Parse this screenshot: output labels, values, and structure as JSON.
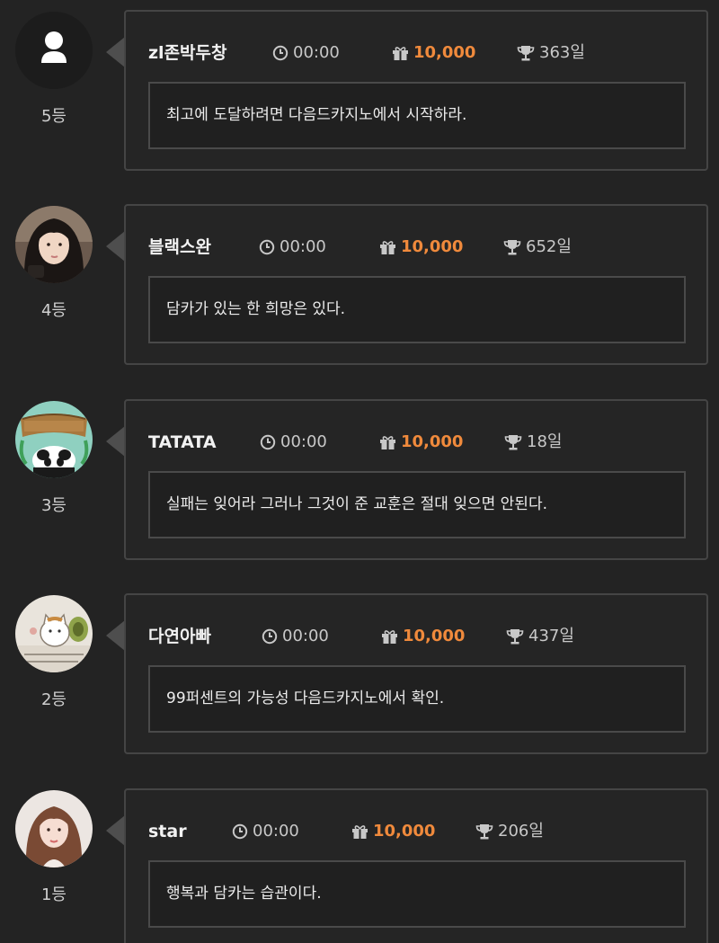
{
  "entries": [
    {
      "name": "zl존박두창",
      "time": "00:00",
      "gift": "10,000",
      "days": "363일",
      "message": "최고에 도달하려면 다음드카지노에서 시작하라.",
      "rank": "5등",
      "avatar": "default-user"
    },
    {
      "name": "블랙스완",
      "time": "00:00",
      "gift": "10,000",
      "days": "652일",
      "message": "담카가 있는 한 희망은 있다.",
      "rank": "4등",
      "avatar": "photo-woman-dark-hair"
    },
    {
      "name": "TATATA",
      "time": "00:00",
      "gift": "10,000",
      "days": "18일",
      "message": "실패는 잊어라 그러나 그것이 준 교훈은 절대 잊으면 안된다.",
      "rank": "3등",
      "avatar": "panda-sign"
    },
    {
      "name": "다연아빠",
      "time": "00:00",
      "gift": "10,000",
      "days": "437일",
      "message": "99퍼센트의 가능성 다음드카지노에서 확인.",
      "rank": "2등",
      "avatar": "cat-illustration"
    },
    {
      "name": "star",
      "time": "00:00",
      "gift": "10,000",
      "days": "206일",
      "message": "행복과 담카는 습관이다.",
      "rank": "1등",
      "avatar": "photo-woman-light-hair"
    }
  ],
  "colors": {
    "accent": "#f08a3c",
    "background": "#232323",
    "card_border": "#454545"
  },
  "icons": {
    "time": "clock-icon",
    "gift": "gift-icon",
    "days": "trophy-icon"
  }
}
